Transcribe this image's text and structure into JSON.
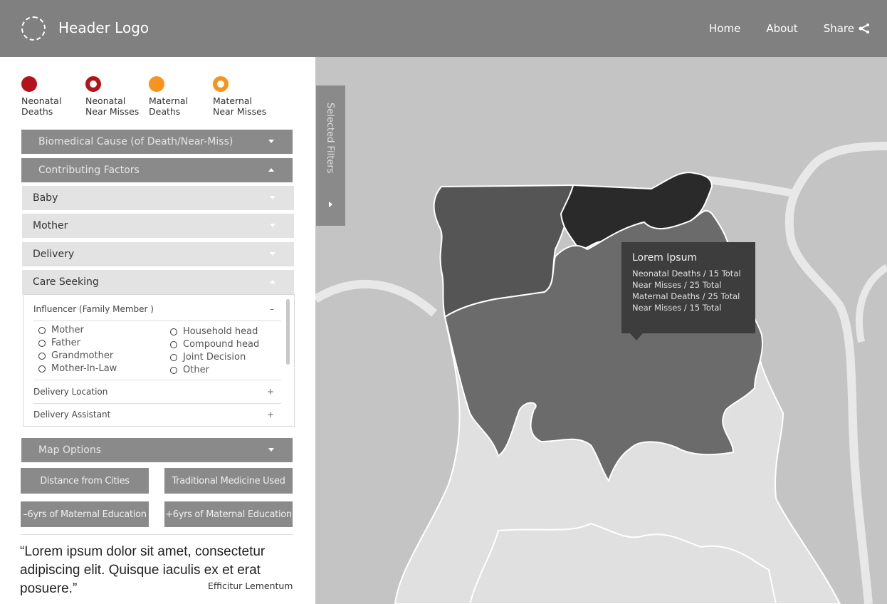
{
  "header": {
    "logo_text": "Header Logo",
    "nav": {
      "home": "Home",
      "about": "About",
      "share": "Share"
    }
  },
  "legend": [
    {
      "label": "Neonatal\nDeaths",
      "color": "#b5121b",
      "style": "solid"
    },
    {
      "label": "Neonatal\nNear Misses",
      "color": "#b5121b",
      "style": "ring"
    },
    {
      "label": "Maternal\nDeaths",
      "color": "#f7941d",
      "style": "solid"
    },
    {
      "label": "Maternal\nNear Misses",
      "color": "#f7941d",
      "style": "ring"
    }
  ],
  "filters": {
    "biomedical": "Biomedical Cause (of Death/Near-Miss)",
    "contributing": "Contributing Factors",
    "baby": "Baby",
    "mother": "Mother",
    "delivery": "Delivery",
    "care_seeking": "Care Seeking"
  },
  "care_panel": {
    "influencer": {
      "label": "Influencer (Family Member )",
      "sign": "–"
    },
    "options_left": [
      "Mother",
      "Father",
      "Grandmother",
      "Mother-In-Law"
    ],
    "options_right": [
      "Household head",
      "Compound head",
      "Joint Decision",
      "Other"
    ],
    "delivery_location": {
      "label": "Delivery Location",
      "sign": "+"
    },
    "delivery_assistant": {
      "label": "Delivery Assistant",
      "sign": "+"
    }
  },
  "map_options": {
    "title": "Map Options",
    "buttons": [
      "Distance from Cities",
      "Traditional Medicine Used",
      "–6yrs of Maternal Education",
      "+6yrs of Maternal Education"
    ]
  },
  "quote": {
    "text": "“Lorem ipsum dolor sit amet, consectetur adipiscing elit. Quisque iaculis ex et erat posuere.”",
    "author": "Efficitur Lementum"
  },
  "selected_filters": "Selected Filters",
  "tooltip": {
    "title": "Lorem Ipsum",
    "lines": [
      "Neonatal Deaths  /  15  Total",
      "Near Misses  /  25  Total",
      "Maternal Deaths  /  25 Total",
      "Near Misses  /  15  Total"
    ]
  }
}
